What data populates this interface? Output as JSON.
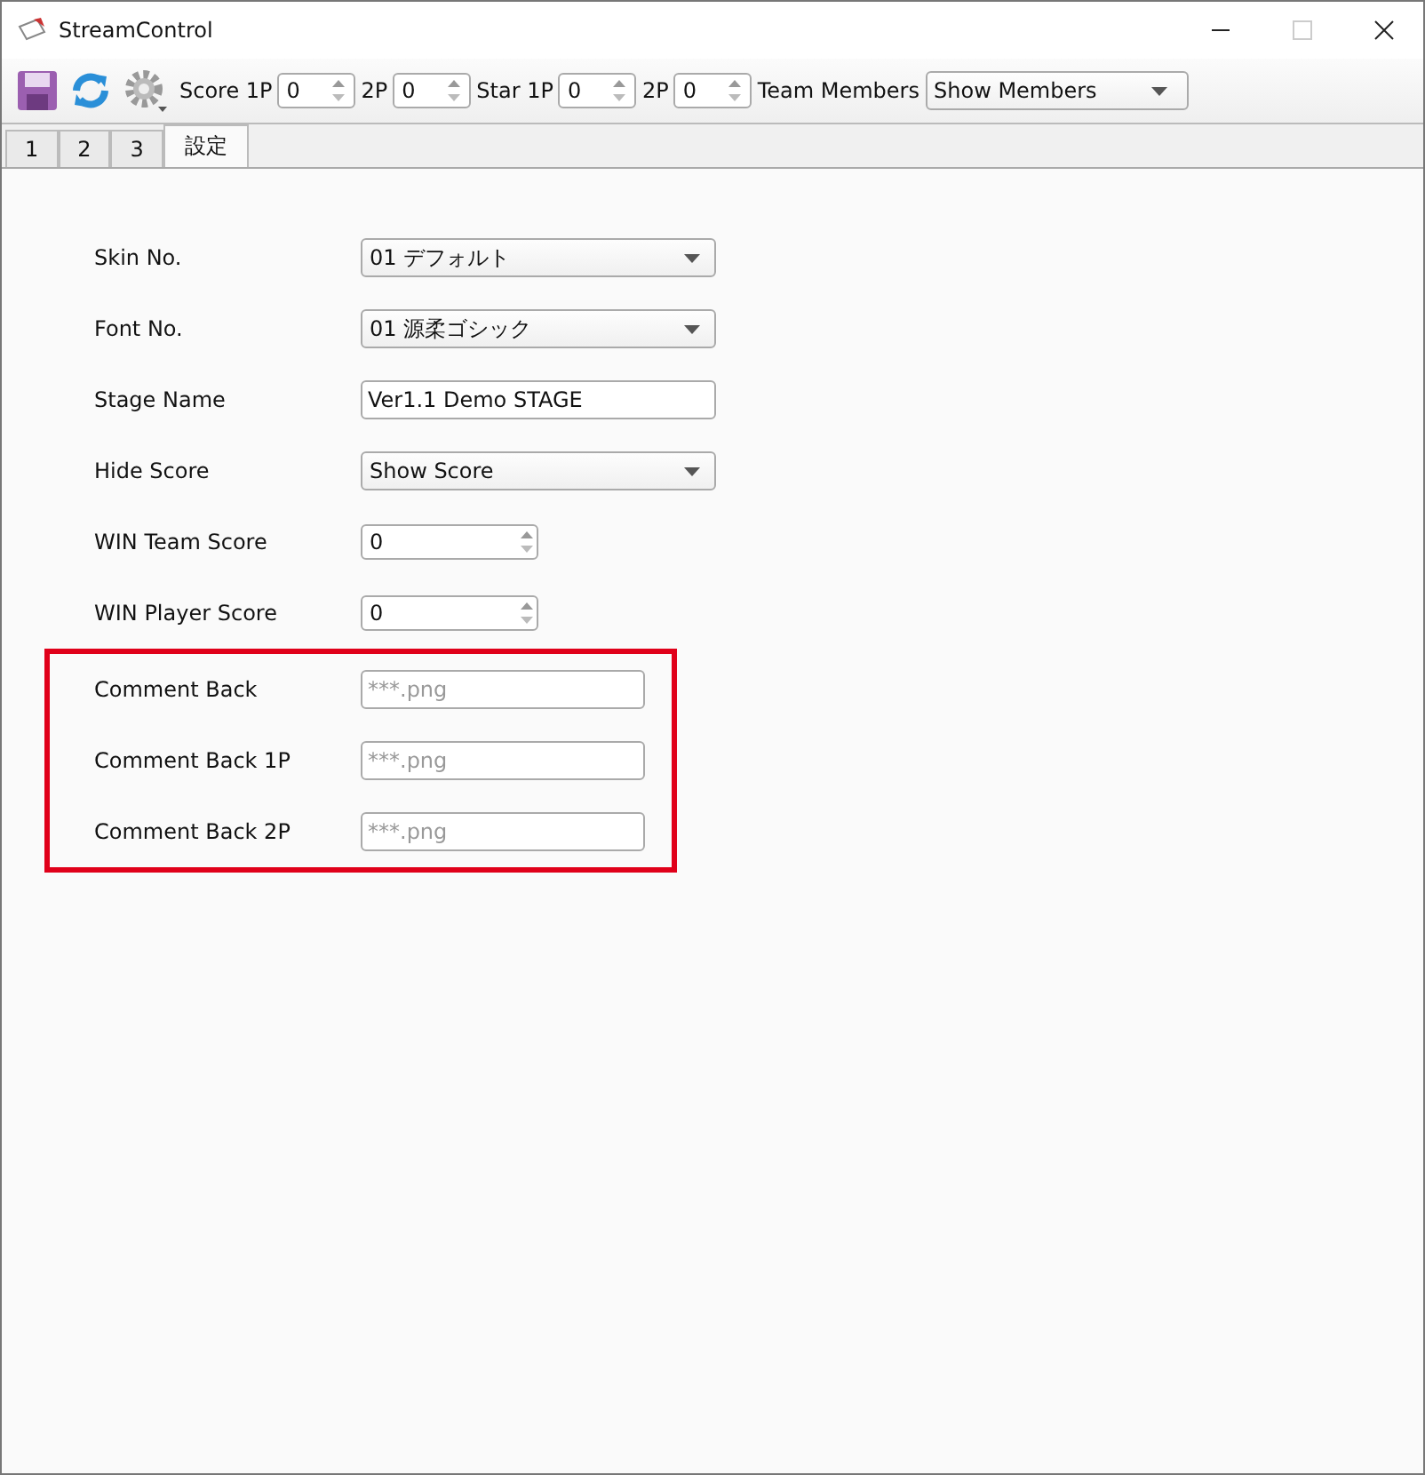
{
  "window": {
    "title": "StreamControl"
  },
  "toolbar": {
    "spinners": [
      {
        "label": "Score 1P",
        "value": "0"
      },
      {
        "label": "2P",
        "value": "0"
      },
      {
        "label": "Star 1P",
        "value": "0"
      },
      {
        "label": "2P",
        "value": "0"
      }
    ],
    "team_members": {
      "label": "Team Members",
      "value": "Show Members"
    }
  },
  "tabs": [
    {
      "label": "1",
      "selected": false
    },
    {
      "label": "2",
      "selected": false
    },
    {
      "label": "3",
      "selected": false
    },
    {
      "label": "設定",
      "selected": true
    }
  ],
  "settings": [
    {
      "label": "Skin No.",
      "kind": "dropdown",
      "value": "01 デフォルト"
    },
    {
      "label": "Font No.",
      "kind": "dropdown",
      "value": "01 源柔ゴシック"
    },
    {
      "label": "Stage Name",
      "kind": "text",
      "value": "Ver1.1 Demo STAGE"
    },
    {
      "label": "Hide Score",
      "kind": "dropdown",
      "value": "Show Score"
    },
    {
      "label": "WIN Team Score",
      "kind": "spinner",
      "value": "0"
    },
    {
      "label": "WIN Player Score",
      "kind": "spinner",
      "value": "0"
    }
  ],
  "highlighted_settings": [
    {
      "label": "Comment Back",
      "kind": "text",
      "placeholder": "***.png"
    },
    {
      "label": "Comment Back 1P",
      "kind": "text",
      "placeholder": "***.png"
    },
    {
      "label": "Comment Back 2P",
      "kind": "text",
      "placeholder": "***.png"
    }
  ]
}
